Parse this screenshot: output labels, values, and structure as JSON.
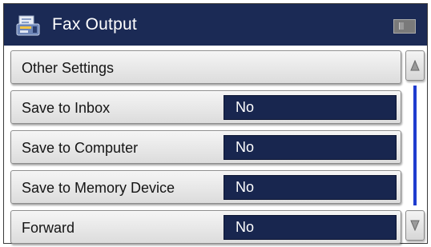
{
  "window": {
    "title": "Fax Output",
    "icon": "fax-output-icon",
    "status_icon": "status-indicator-icon"
  },
  "settings": {
    "header_item": {
      "label": "Other Settings"
    },
    "items": [
      {
        "label": "Save to Inbox",
        "value": "No"
      },
      {
        "label": "Save to Computer",
        "value": "No"
      },
      {
        "label": "Save to Memory Device",
        "value": "No"
      },
      {
        "label": "Forward",
        "value": "No"
      }
    ]
  },
  "scrollbar": {
    "up_icon": "scroll-up-arrow-icon",
    "down_icon": "scroll-down-arrow-icon",
    "position_fraction": 0.0
  },
  "colors": {
    "titlebar": "#1b2a55",
    "value_box": "#18264f",
    "scroll_thumb": "#1f3ccf"
  }
}
